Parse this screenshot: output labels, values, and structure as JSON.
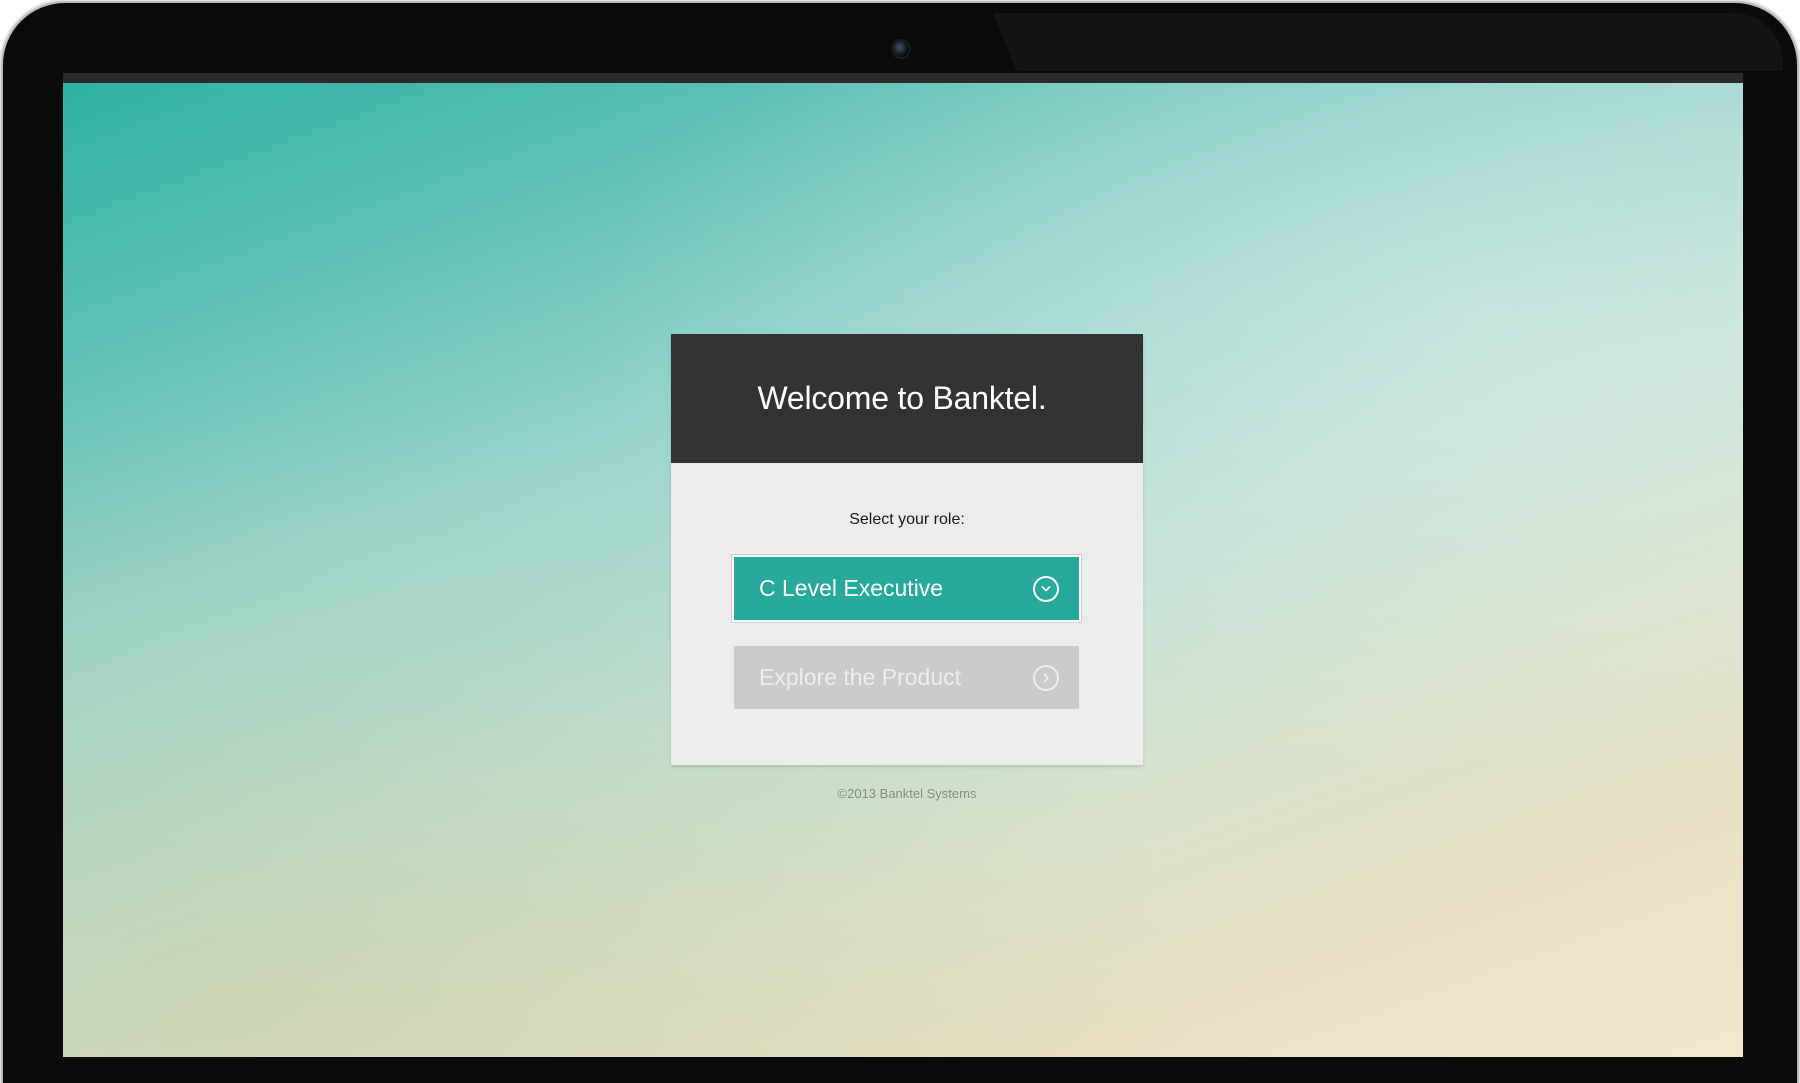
{
  "welcome": {
    "title": "Welcome to Banktel."
  },
  "role": {
    "prompt": "Select your role:",
    "selected": "C Level Executive",
    "icon": "chevron-down-circle-icon"
  },
  "explore": {
    "label": "Explore the Product",
    "icon": "chevron-right-circle-icon"
  },
  "footer": {
    "copyright": "©2013 Banktel Systems"
  },
  "colors": {
    "accent": "#27a99c",
    "header": "#333333",
    "card": "#ececec",
    "disabled": "#cbcbcb"
  }
}
